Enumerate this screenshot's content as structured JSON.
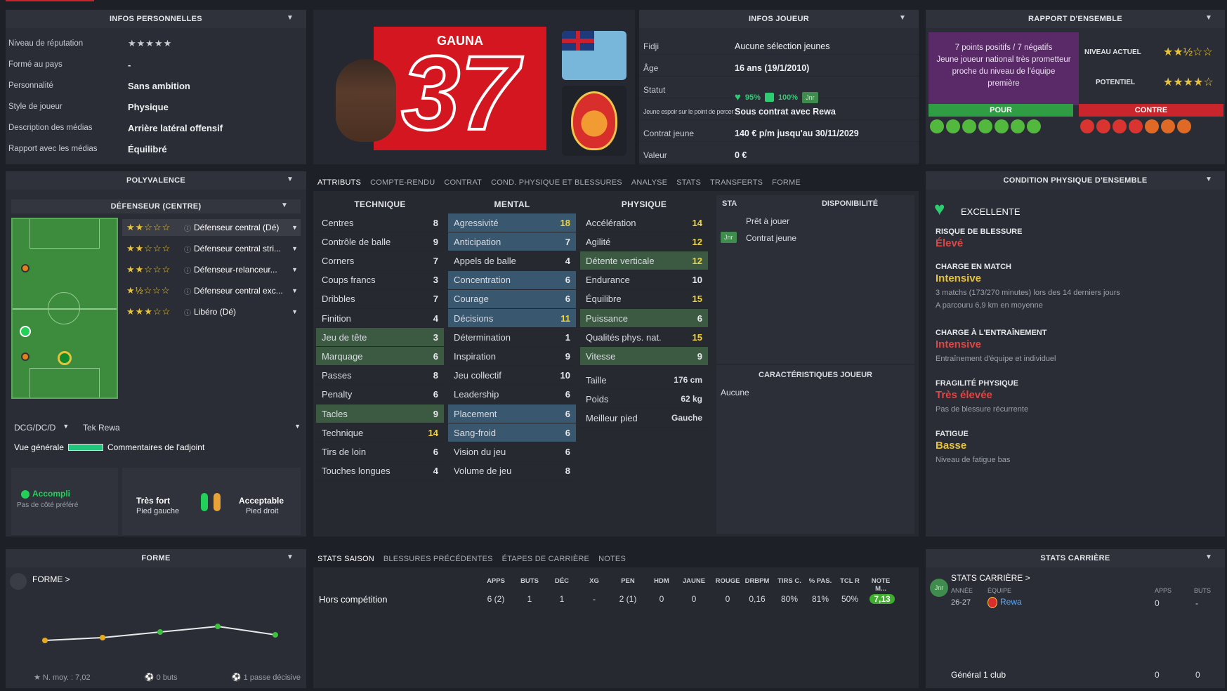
{
  "personal": {
    "title": "INFOS PERSONNELLES",
    "rows": [
      {
        "label": "Niveau de réputation",
        "value": "★★★★★"
      },
      {
        "label": "Formé au pays",
        "value": "-"
      },
      {
        "label": "Personnalité",
        "value": "Sans ambition"
      },
      {
        "label": "Style de joueur",
        "value": "Physique"
      },
      {
        "label": "Description des médias",
        "value": "Arrière latéral offensif"
      },
      {
        "label": "Rapport avec les médias",
        "value": "Équilibré"
      }
    ]
  },
  "card": {
    "name": "GAUNA",
    "number": "37",
    "club_crest": "REWA F.C. TABU SORO"
  },
  "player_info": {
    "title": "INFOS JOUEUR",
    "rows": [
      {
        "label": "Fidji",
        "value": "Aucune sélection jeunes"
      },
      {
        "label": "Âge",
        "value": "16 ans (19/1/2010)"
      },
      {
        "label": "Statut",
        "value": ""
      },
      {
        "label": "Jeune espoir sur le point de percer",
        "value": "Sous contrat avec Rewa"
      },
      {
        "label": "Contrat jeune",
        "value": "140 € p/m jusqu'au 30/11/2029"
      },
      {
        "label": "Valeur",
        "value": "0 €"
      }
    ],
    "status_fitness": "95%",
    "status_morale": "100%",
    "status_badge": "Jnr"
  },
  "overview": {
    "title": "RAPPORT D'ENSEMBLE",
    "summary_line": "7 points positifs / 7 négatifs",
    "summary_text": "Jeune joueur national très prometteur proche du niveau de l'équipe première",
    "current_label": "NIVEAU ACTUEL",
    "current_stars": "★★½☆☆",
    "potential_label": "POTENTIEL",
    "potential_stars": "★★★★☆",
    "pro_label": "POUR",
    "con_label": "CONTRE",
    "colors": {
      "pro": "#2e9d43",
      "con": "#c8262c",
      "summary_bg": "#5a2968"
    }
  },
  "versatility": {
    "title": "POLYVALENCE",
    "position_header": "DÉFENSEUR (CENTRE)",
    "roles": [
      {
        "stars": "★★☆☆☆",
        "name": "Défenseur central (Dé)"
      },
      {
        "stars": "★★☆☆☆",
        "name": "Défenseur central stri..."
      },
      {
        "stars": "★★☆☆☆",
        "name": "Défenseur-relanceur..."
      },
      {
        "stars": "★½☆☆☆",
        "name": "Défenseur central exc..."
      },
      {
        "stars": "★★★☆☆",
        "name": "Libéro (Dé)"
      }
    ],
    "position_select": "DCG/DC/D",
    "team_select": "Tek Rewa",
    "overview_label": "Vue générale",
    "assistant_label": "Commentaires de l'adjoint"
  },
  "feet": {
    "side_title": "Accompli",
    "side_sub": "Pas de côté préféré",
    "left_title": "Très fort",
    "left_sub": "Pied gauche",
    "right_title": "Acceptable",
    "right_sub": "Pied droit"
  },
  "tabs": [
    "ATTRIBUTS",
    "COMPTE-RENDU",
    "CONTRAT",
    "COND. PHYSIQUE ET BLESSURES",
    "ANALYSE",
    "STATS",
    "TRANSFERTS",
    "FORME"
  ],
  "attributes": {
    "technique_title": "TECHNIQUE",
    "mental_title": "MENTAL",
    "physique_title": "PHYSIQUE",
    "technique": [
      [
        "Centres",
        "8"
      ],
      [
        "Contrôle de balle",
        "9"
      ],
      [
        "Corners",
        "7"
      ],
      [
        "Coups francs",
        "3"
      ],
      [
        "Dribbles",
        "7"
      ],
      [
        "Finition",
        "4"
      ],
      [
        "Jeu de tête",
        "3"
      ],
      [
        "Marquage",
        "6"
      ],
      [
        "Passes",
        "8"
      ],
      [
        "Penalty",
        "6"
      ],
      [
        "Tacles",
        "9"
      ],
      [
        "Technique",
        "14"
      ],
      [
        "Tirs de loin",
        "6"
      ],
      [
        "Touches longues",
        "4"
      ]
    ],
    "mental": [
      [
        "Agressivité",
        "18"
      ],
      [
        "Anticipation",
        "7"
      ],
      [
        "Appels de balle",
        "4"
      ],
      [
        "Concentration",
        "6"
      ],
      [
        "Courage",
        "6"
      ],
      [
        "Décisions",
        "11"
      ],
      [
        "Détermination",
        "1"
      ],
      [
        "Inspiration",
        "9"
      ],
      [
        "Jeu collectif",
        "10"
      ],
      [
        "Leadership",
        "6"
      ],
      [
        "Placement",
        "6"
      ],
      [
        "Sang-froid",
        "6"
      ],
      [
        "Vision du jeu",
        "6"
      ],
      [
        "Volume de jeu",
        "8"
      ]
    ],
    "physique": [
      [
        "Accélération",
        "14"
      ],
      [
        "Agilité",
        "12"
      ],
      [
        "Détente verticale",
        "12"
      ],
      [
        "Endurance",
        "10"
      ],
      [
        "Équilibre",
        "15"
      ],
      [
        "Puissance",
        "6"
      ],
      [
        "Qualités phys. nat.",
        "15"
      ],
      [
        "Vitesse",
        "9"
      ]
    ],
    "height_label": "Taille",
    "height": "176 cm",
    "weight_label": "Poids",
    "weight": "62 kg",
    "foot_label": "Meilleur pied",
    "foot": "Gauche"
  },
  "availability": {
    "sta": "STA",
    "title": "DISPONIBILITÉ",
    "row1": "Prêt à jouer",
    "row2": "Contrat jeune",
    "badge": "Jnr"
  },
  "characteristics": {
    "title": "CARACTÉRISTIQUES JOUEUR",
    "value": "Aucune"
  },
  "condition": {
    "title": "CONDITION PHYSIQUE D'ENSEMBLE",
    "overall": "EXCELLENTE",
    "injury_label": "RISQUE DE BLESSURE",
    "injury": "Élevé",
    "match_label": "CHARGE EN MATCH",
    "match": "Intensive",
    "match_sub1": "3 matchs (173/270 minutes) lors des 14 derniers jours",
    "match_sub2": "A parcouru 6,9 km en moyenne",
    "training_label": "CHARGE À L'ENTRAÎNEMENT",
    "training": "Intensive",
    "training_sub": "Entraînement d'équipe et individuel",
    "fragility_label": "FRAGILITÉ PHYSIQUE",
    "fragility": "Très élevée",
    "fragility_sub": "Pas de blessure récurrente",
    "fatigue_label": "FATIGUE",
    "fatigue": "Basse",
    "fatigue_sub": "Niveau de fatigue bas"
  },
  "form": {
    "title": "FORME",
    "link": "FORME >",
    "avg": "N. moy. : 7,02",
    "goals": "0 buts",
    "assists": "1 passe décisive",
    "points": [
      7.0,
      7.05,
      7.15,
      7.25,
      7.1
    ]
  },
  "season": {
    "tabs": [
      "STATS SAISON",
      "BLESSURES PRÉCÉDENTES",
      "ÉTAPES DE CARRIÈRE",
      "NOTES"
    ],
    "headers": [
      "APPS",
      "BUTS",
      "DÉC",
      "XG",
      "PEN",
      "HDM",
      "JAUNE",
      "ROUGE",
      "DRBPM",
      "TIRS C.",
      "% PAS.",
      "TCL R",
      "NOTE M..."
    ],
    "row_label": "Hors compétition",
    "row": [
      "6 (2)",
      "1",
      "1",
      "-",
      "2 (1)",
      "0",
      "0",
      "0",
      "0,16",
      "80%",
      "81%",
      "50%",
      "7,13"
    ]
  },
  "career": {
    "title": "STATS CARRIÈRE",
    "link": "STATS CARRIÈRE >",
    "badge": "Jnr",
    "year_h": "ANNÉE",
    "team_h": "ÉQUIPE",
    "apps_h": "APPS",
    "goals_h": "BUTS",
    "year": "26-27",
    "team": "Rewa",
    "apps": "0",
    "goals": "-",
    "total_label": "Général 1 club",
    "total_apps": "0",
    "total_goals": "0"
  }
}
